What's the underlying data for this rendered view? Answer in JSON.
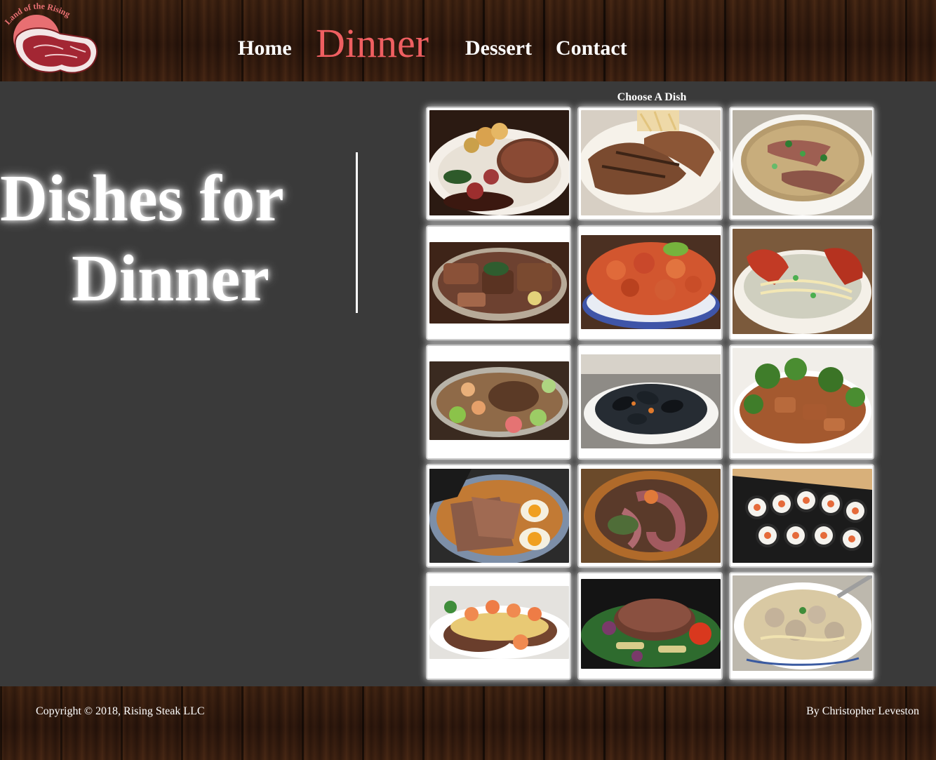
{
  "header": {
    "logo_text": "Land of the Rising Steak",
    "nav": {
      "home": "Home",
      "dinner": "Dinner",
      "dessert": "Dessert",
      "contact": "Contact"
    }
  },
  "hero": {
    "line1": "Dishes for",
    "line2": "Dinner"
  },
  "dishes": {
    "heading": "Choose A Dish",
    "items": [
      {
        "icon": "steak-with-roast-potatoes"
      },
      {
        "icon": "grilled-pork-chops-with-fries"
      },
      {
        "icon": "beef-pho-soup"
      },
      {
        "icon": "mixed-grill-platter"
      },
      {
        "icon": "crawfish-bowl"
      },
      {
        "icon": "lobster-noodle-soup"
      },
      {
        "icon": "seafood-steak-platter"
      },
      {
        "icon": "mussels-plate"
      },
      {
        "icon": "broccoli-beef-stir-fry"
      },
      {
        "icon": "ramen-with-pork-and-egg"
      },
      {
        "icon": "octopus-dish"
      },
      {
        "icon": "sushi-rolls"
      },
      {
        "icon": "steak-with-shrimp"
      },
      {
        "icon": "steak-salad"
      },
      {
        "icon": "meatball-noodle-soup"
      }
    ]
  },
  "footer": {
    "copyright": "Copyright © 2018, Rising Steak LLC",
    "author": "By Christopher Leveston"
  },
  "colors": {
    "accent": "#ef5f61",
    "background": "#3a3a3a",
    "wood": "#2a160c",
    "text": "#ffffff"
  }
}
